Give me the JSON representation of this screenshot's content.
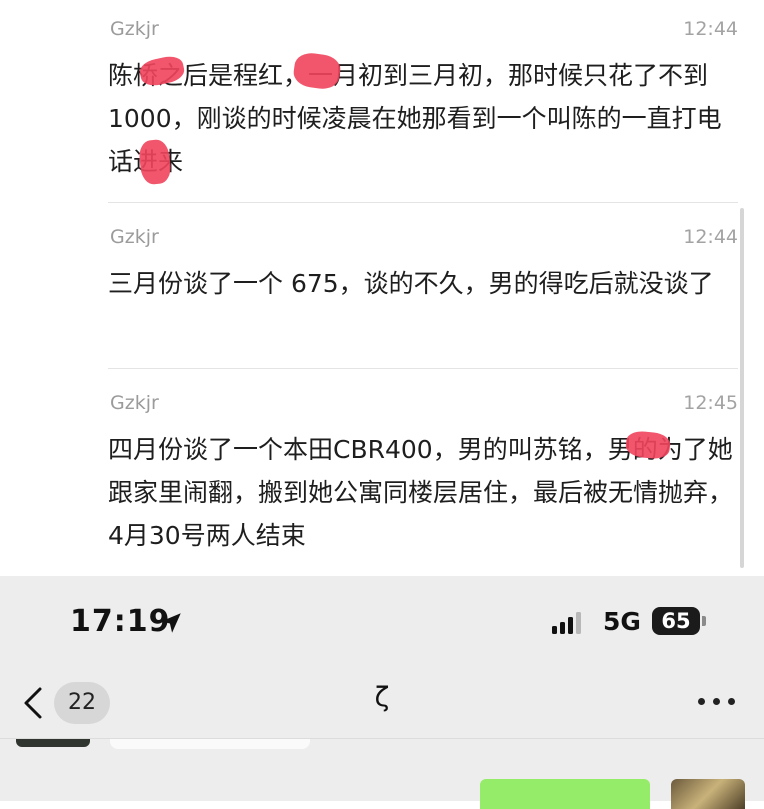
{
  "messages": [
    {
      "sender": "Gzkjr",
      "time": "12:44",
      "text": "陈桥之后是程红，一月初到三月初，那时候只花了不到1000，刚谈的时候凌晨在她那看到一个叫陈的一直打电话进来"
    },
    {
      "sender": "Gzkjr",
      "time": "12:44",
      "text": "三月份谈了一个 675，谈的不久，男的得吃后就没谈了"
    },
    {
      "sender": "Gzkjr",
      "time": "12:45",
      "text": "四月份谈了一个本田CBR400，男的叫苏铭，男的为了她跟家里闹翻，搬到她公寓同楼层居住，最后被无情抛弃，4月30号两人结束"
    }
  ],
  "status_bar": {
    "time": "17:19",
    "network": "5G",
    "battery": "65",
    "location_icon": "location-arrow-icon",
    "signal_icon": "signal-bars-icon"
  },
  "nav": {
    "back_icon": "chevron-left-icon",
    "unread_count": "22",
    "title": "ζ",
    "more_icon": "more-dots-icon"
  },
  "colors": {
    "redaction": "#f0445c",
    "bubble_green": "#95ec69",
    "nav_background": "#ededed"
  }
}
